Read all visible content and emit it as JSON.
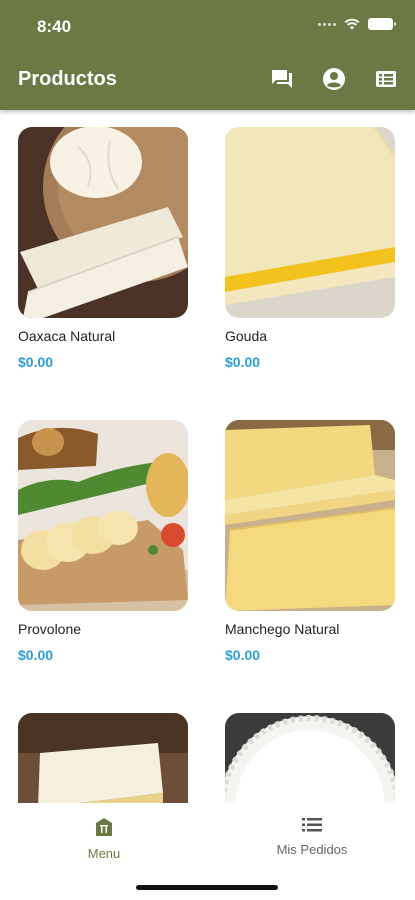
{
  "status_bar": {
    "time": "8:40"
  },
  "appbar": {
    "title": "Productos",
    "actions": [
      "chat-icon",
      "account-icon",
      "list-view-icon"
    ]
  },
  "products": [
    {
      "name": "Oaxaca Natural",
      "price": "$0.00"
    },
    {
      "name": "Gouda",
      "price": "$0.00"
    },
    {
      "name": "Provolone",
      "price": "$0.00"
    },
    {
      "name": "Manchego Natural",
      "price": "$0.00"
    },
    {
      "name": "",
      "price": ""
    },
    {
      "name": "",
      "price": ""
    }
  ],
  "bottom_nav": {
    "items": [
      {
        "label": "Menu",
        "icon": "store-icon",
        "active": true
      },
      {
        "label": "Mis Pedidos",
        "icon": "list-icon",
        "active": false
      }
    ]
  },
  "colors": {
    "primary": "#6b7a44",
    "price": "#2a9fd8",
    "nav_active": "#6b7a44",
    "nav_inactive": "#666666"
  }
}
